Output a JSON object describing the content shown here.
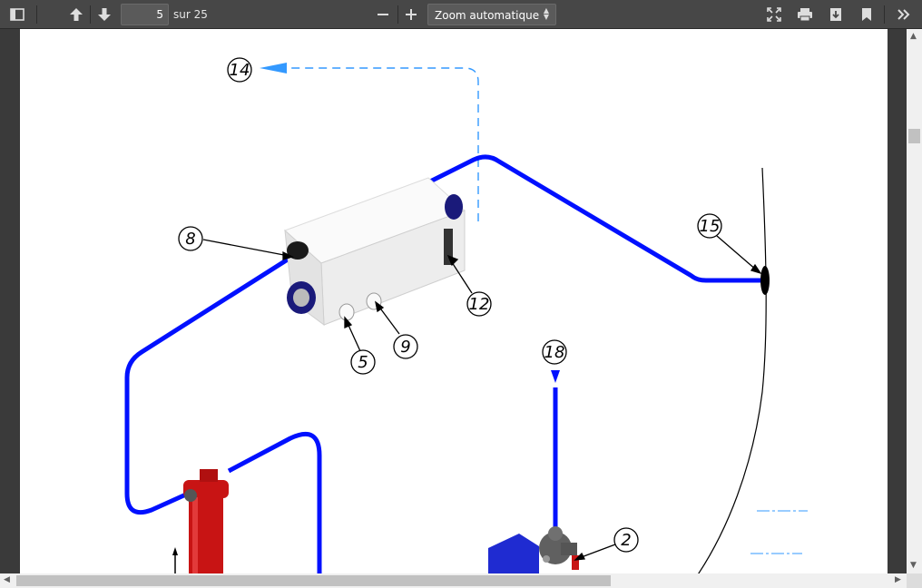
{
  "toolbar": {
    "page_number": "5",
    "page_total": "sur 25",
    "zoom_label": "Zoom automatique",
    "icons": [
      "sidebar-toggle-icon",
      "arrow-up-icon",
      "arrow-down-icon",
      "zoom-out-icon",
      "zoom-in-icon",
      "fullscreen-icon",
      "print-icon",
      "download-icon",
      "bookmark-icon",
      "more-tools-icon"
    ]
  },
  "document": {
    "callouts": [
      "14",
      "8",
      "12",
      "5",
      "9",
      "15",
      "18",
      "2"
    ]
  },
  "colors": {
    "toolbar_bg": "#474747",
    "pipe_blue": "#0010ff",
    "dashed_blue": "#3399ff",
    "filter_red": "#c81414"
  }
}
